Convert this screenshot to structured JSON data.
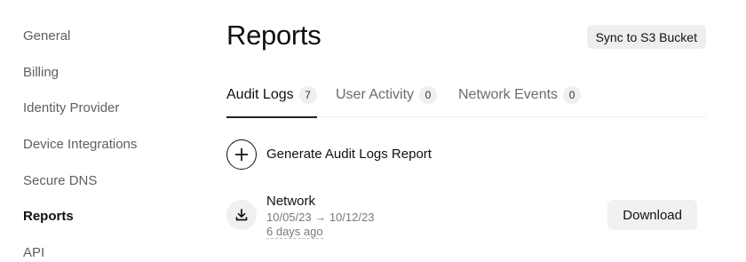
{
  "sidebar": {
    "items": [
      {
        "label": "General"
      },
      {
        "label": "Billing"
      },
      {
        "label": "Identity Provider"
      },
      {
        "label": "Device Integrations"
      },
      {
        "label": "Secure DNS"
      },
      {
        "label": "Reports",
        "active": true
      },
      {
        "label": "API"
      }
    ]
  },
  "header": {
    "title": "Reports",
    "sync_label": "Sync to S3 Bucket"
  },
  "tabs": [
    {
      "label": "Audit Logs",
      "count": "7",
      "active": true
    },
    {
      "label": "User Activity",
      "count": "0"
    },
    {
      "label": "Network Events",
      "count": "0"
    }
  ],
  "generate": {
    "label": "Generate Audit Logs Report",
    "icon": "plus-circle-icon"
  },
  "reports": [
    {
      "name": "Network",
      "range": "10/05/23 → 10/12/23",
      "age": "6 days ago",
      "download_label": "Download",
      "icon": "download-icon"
    }
  ],
  "colors": {
    "text": "#111111",
    "muted": "#6b6b6b",
    "button_bg": "#eeeeee",
    "badge_bg": "#efefef"
  }
}
